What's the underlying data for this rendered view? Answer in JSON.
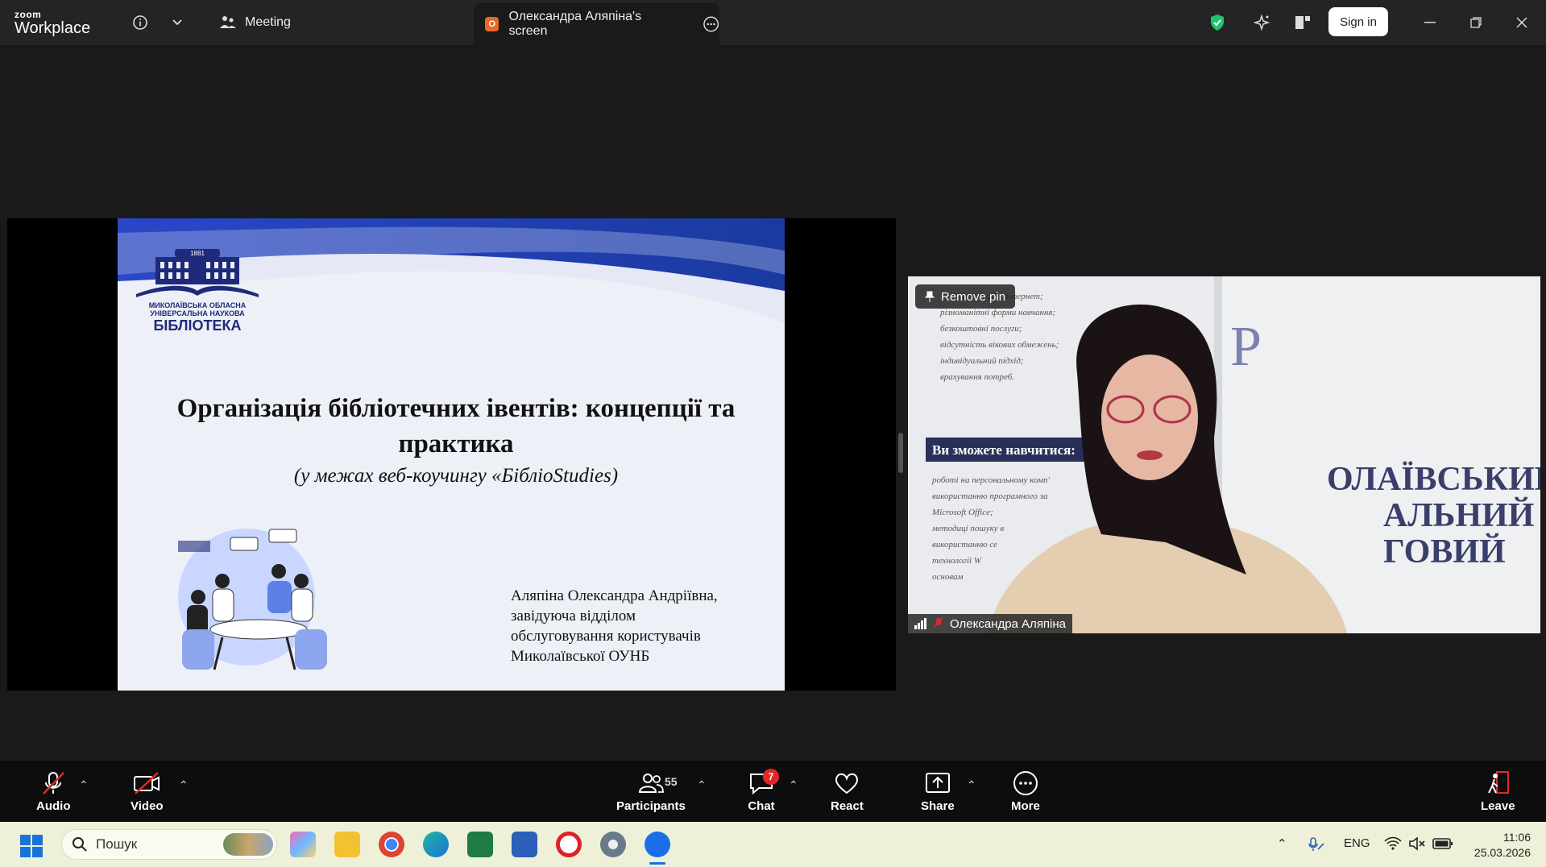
{
  "titlebar": {
    "logo_line1": "zoom",
    "logo_line2": "Workplace",
    "meeting_label": "Meeting",
    "active_tab": "Олександра Аляпіна's screen",
    "signin_label": "Sign in"
  },
  "slide": {
    "logo_year": "1881",
    "logo_line1": "МИКОЛАЇВСЬКА ОБЛАСНА",
    "logo_line2": "УНІВЕРСАЛЬНА НАУКОВА",
    "logo_line3": "БІБЛІОТЕКА",
    "title": "Організація бібліотечних івентів: концепції та практика",
    "subtitle": "(у межах веб-коучингу «БібліоStudies)",
    "author_line1": "Аляпіна Олександра Андріївна,",
    "author_line2": "завідуюча відділом",
    "author_line3": "обслуговування користувачів",
    "author_line4": "Миколаївської ОУНБ"
  },
  "camera": {
    "remove_pin": "Remove pin",
    "participant_name": "Олександра Аляпіна",
    "poster_heading": "Ви зможете навчитися:",
    "poster_items": [
      "Wi-Fi доступ до Інтернет;",
      "різноманітні форми навчання;",
      "безкоштовні послуги;",
      "відсутність вікових обмежень;",
      "індивідуальний підхід;",
      "врахування потреб."
    ],
    "poster_items2": [
      "роботі на персональному комп'",
      "використанню програмного за",
      "Microsoft Office;",
      "методиці пошуку в",
      "використанню се",
      "технології W",
      "основам"
    ],
    "wall_text": [
      "ОЛАЇВСЬКИЙ",
      "АЛЬНИЙ",
      "ГОВИЙ"
    ]
  },
  "toolbar": {
    "audio": "Audio",
    "video": "Video",
    "participants": "Participants",
    "participants_count": "55",
    "chat": "Chat",
    "chat_badge": "7",
    "react": "React",
    "share": "Share",
    "more": "More",
    "leave": "Leave"
  },
  "taskbar": {
    "search_placeholder": "Пошук",
    "lang": "ENG",
    "time": "11:06",
    "date": "25.03.2026"
  },
  "colors": {
    "titlebar_bg": "#242424",
    "toolbar_bg": "#0d0d0d",
    "accent_red": "#e02828",
    "shield_green": "#1fc46b",
    "library_blue": "#1f2a7a"
  }
}
